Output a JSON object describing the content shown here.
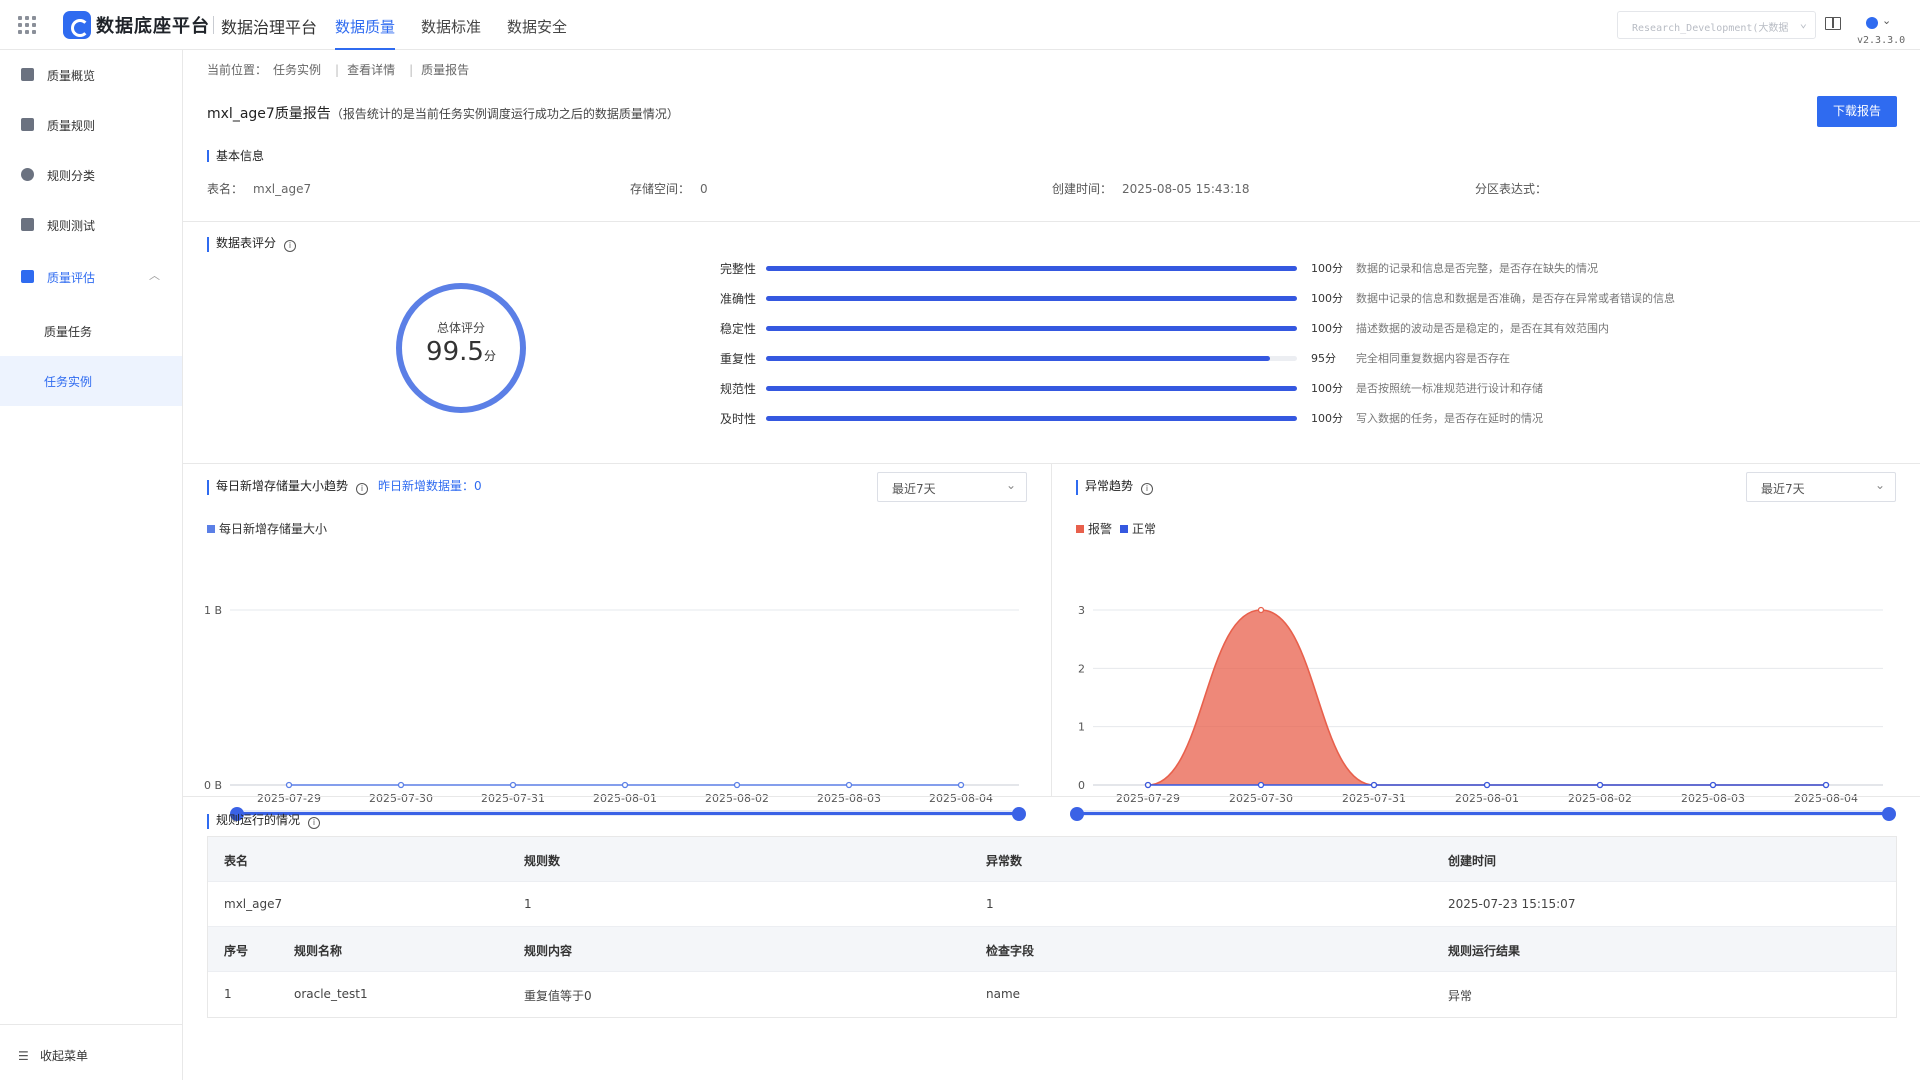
{
  "header": {
    "brand": "数据底座平台",
    "sub_brand": "数据治理平台",
    "tabs": [
      {
        "label": "数据质量",
        "active": true
      },
      {
        "label": "数据标准",
        "active": false
      },
      {
        "label": "数据安全",
        "active": false
      }
    ],
    "project": "Research_Development(大数据",
    "version": "v2.3.3.0"
  },
  "sidebar": {
    "items": [
      {
        "label": "质量概览",
        "icon": "monitor-icon"
      },
      {
        "label": "质量规则",
        "icon": "document-icon"
      },
      {
        "label": "规则分类",
        "icon": "category-icon"
      },
      {
        "label": "规则测试",
        "icon": "test-icon"
      },
      {
        "label": "质量评估",
        "icon": "assessment-icon",
        "expanded": true
      }
    ],
    "sub_items": [
      {
        "label": "质量任务",
        "active": false
      },
      {
        "label": "任务实例",
        "active": true
      }
    ],
    "collapse_label": "收起菜单"
  },
  "breadcrumb": {
    "prefix": "当前位置：",
    "items": [
      "任务实例",
      "查看详情",
      "质量报告"
    ]
  },
  "report": {
    "title": "mxl_age7质量报告",
    "note": "（报告统计的是当前任务实例调度运行成功之后的数据质量情况）",
    "download_label": "下载报告"
  },
  "basic_info": {
    "title": "基本信息",
    "table_name_label": "表名：",
    "table_name": "mxl_age7",
    "storage_label": "存储空间：",
    "storage": "0",
    "created_label": "创建时间：",
    "created": "2025-08-05 15:43:18",
    "partition_label": "分区表达式：",
    "partition": ""
  },
  "score": {
    "title": "数据表评分",
    "total_label": "总体评分",
    "total_value": "99.5",
    "total_unit": "分",
    "metrics": [
      {
        "name": "完整性",
        "percent": 100,
        "score": "100分",
        "desc": "数据的记录和信息是否完整，是否存在缺失的情况"
      },
      {
        "name": "准确性",
        "percent": 100,
        "score": "100分",
        "desc": "数据中记录的信息和数据是否准确，是否存在异常或者错误的信息"
      },
      {
        "name": "稳定性",
        "percent": 100,
        "score": "100分",
        "desc": "描述数据的波动是否是稳定的，是否在其有效范围内"
      },
      {
        "name": "重复性",
        "percent": 95,
        "score": "95分",
        "desc": "完全相同重复数据内容是否存在"
      },
      {
        "name": "规范性",
        "percent": 100,
        "score": "100分",
        "desc": "是否按照统一标准规范进行设计和存储"
      },
      {
        "name": "及时性",
        "percent": 100,
        "score": "100分",
        "desc": "写入数据的任务，是否存在延时的情况"
      }
    ]
  },
  "storage_trend": {
    "title": "每日新增存储量大小趋势",
    "yesterday_label": "昨日新增数据量：",
    "yesterday_value": "0",
    "range_label": "最近7天",
    "color": "#5b7fe6"
  },
  "anomaly_trend": {
    "title": "异常趋势",
    "range_label": "最近7天",
    "alert_color": "#e8604c",
    "normal_color": "#3558e0"
  },
  "chart_data": [
    {
      "type": "line",
      "x": [
        "2025-07-29",
        "2025-07-30",
        "2025-07-31",
        "2025-08-01",
        "2025-08-02",
        "2025-08-03",
        "2025-08-04"
      ],
      "series": [
        {
          "name": "每日新增存储量大小",
          "values": [
            0,
            0,
            0,
            0,
            0,
            0,
            0
          ]
        }
      ],
      "yticks": [
        "0 B",
        "1 B"
      ],
      "ylim": [
        0,
        1
      ],
      "legend": "top-left",
      "grid": true
    },
    {
      "type": "area",
      "x": [
        "2025-07-29",
        "2025-07-30",
        "2025-07-31",
        "2025-08-01",
        "2025-08-02",
        "2025-08-03",
        "2025-08-04"
      ],
      "series": [
        {
          "name": "报警",
          "values": [
            0,
            3,
            0,
            0,
            0,
            0,
            0
          ]
        },
        {
          "name": "正常",
          "values": [
            0,
            0,
            0,
            0,
            0,
            0,
            0
          ]
        }
      ],
      "yticks": [
        "0",
        "1",
        "2",
        "3"
      ],
      "ylim": [
        0,
        3
      ],
      "legend": "top-left",
      "grid": true
    }
  ],
  "rules": {
    "title": "规则运行的情况",
    "summary_headers": [
      "表名",
      "规则数",
      "异常数",
      "创建时间"
    ],
    "summary_row": [
      "mxl_age7",
      "1",
      "1",
      "2025-07-23 15:15:07"
    ],
    "detail_headers": [
      "序号",
      "规则名称",
      "规则内容",
      "检查字段",
      "规则运行结果"
    ],
    "detail_rows": [
      [
        "1",
        "oracle_test1",
        "重复值等于0",
        "name",
        "异常"
      ]
    ]
  }
}
